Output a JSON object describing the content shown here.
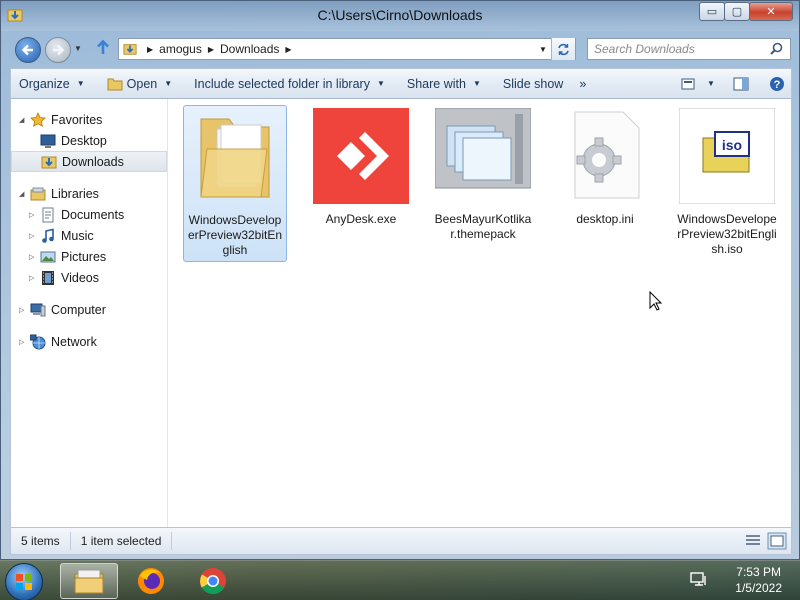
{
  "window": {
    "title": "C:\\Users\\Cirno\\Downloads",
    "min_symbol": "▭",
    "max_symbol": "▢",
    "close_symbol": "✕"
  },
  "nav": {
    "breadcrumb": [
      "amogus",
      "Downloads"
    ],
    "search_placeholder": "Search Downloads"
  },
  "toolbar": {
    "items": [
      {
        "label": "Organize",
        "caret": true
      },
      {
        "label": "Open",
        "caret": true
      },
      {
        "label": "Include selected folder in library",
        "caret": true
      },
      {
        "label": "Share with",
        "caret": true
      },
      {
        "label": "Slide show",
        "caret": false
      },
      {
        "label": "»",
        "caret": false
      }
    ]
  },
  "sidebar": {
    "favorites": {
      "label": "Favorites",
      "items": [
        {
          "label": "Desktop"
        },
        {
          "label": "Downloads"
        }
      ]
    },
    "libraries": {
      "label": "Libraries",
      "items": [
        {
          "label": "Documents"
        },
        {
          "label": "Music"
        },
        {
          "label": "Pictures"
        },
        {
          "label": "Videos"
        }
      ]
    },
    "computer": {
      "label": "Computer"
    },
    "network": {
      "label": "Network"
    }
  },
  "files": [
    {
      "name": "WindowsDeveloperPreview32bitEnglish",
      "icon": "folder-icon",
      "selected": true
    },
    {
      "name": "AnyDesk.exe",
      "icon": "anydesk-icon",
      "selected": false
    },
    {
      "name": "BeesMayurKotlikar.themepack",
      "icon": "themepack-icon",
      "selected": false
    },
    {
      "name": "desktop.ini",
      "icon": "settings-file-icon",
      "selected": false
    },
    {
      "name": "WindowsDeveloperPreview32bitEnglish.iso",
      "icon": "iso-icon",
      "selected": false
    }
  ],
  "status": {
    "count": "5 items",
    "selection": "1 item selected"
  },
  "taskbar": {
    "time": "7:53 PM",
    "date": "1/5/2022"
  }
}
